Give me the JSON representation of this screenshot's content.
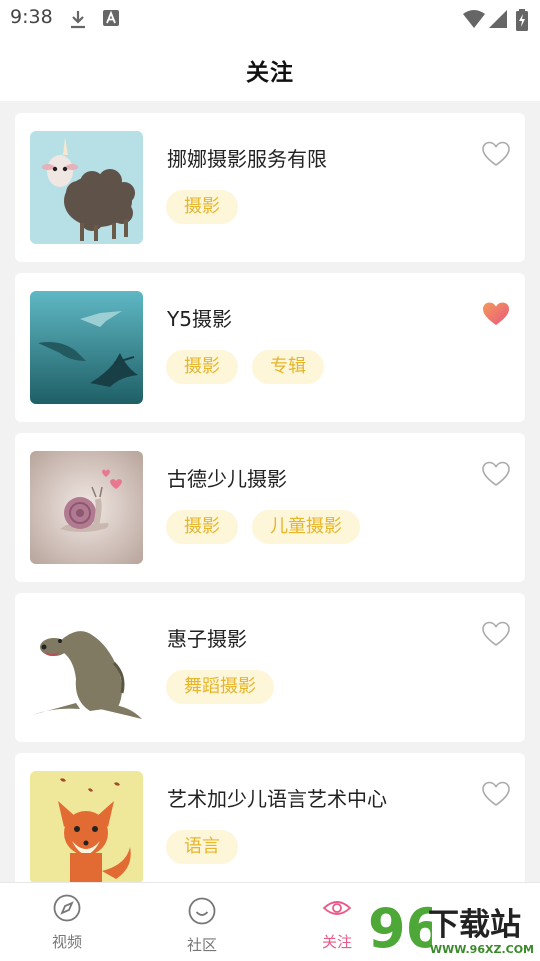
{
  "status": {
    "time": "9:38"
  },
  "header": {
    "title": "关注"
  },
  "items": [
    {
      "name": "挪娜摄影服务有限",
      "tags": [
        "摄影"
      ],
      "favorited": false
    },
    {
      "name": "Y5摄影",
      "tags": [
        "摄影",
        "专辑"
      ],
      "favorited": true
    },
    {
      "name": "古德少儿摄影",
      "tags": [
        "摄影",
        "儿童摄影"
      ],
      "favorited": false
    },
    {
      "name": "惠子摄影",
      "tags": [
        "舞蹈摄影"
      ],
      "favorited": false
    },
    {
      "name": "艺术加少儿语言艺术中心",
      "tags": [
        "语言"
      ],
      "favorited": false
    }
  ],
  "tabbar": {
    "tabs": [
      {
        "label": "视频",
        "icon": "compass-icon",
        "active": false
      },
      {
        "label": "社区",
        "icon": "smile-icon",
        "active": false
      },
      {
        "label": "关注",
        "icon": "eye-icon",
        "active": true
      }
    ]
  },
  "watermark": {
    "digits": "96",
    "text": "下载站",
    "url": "WWW.96XZ.COM"
  },
  "colors": {
    "accent": "#ea5a86",
    "tag_bg": "#fdf6d9",
    "tag_text": "#e7b52a"
  }
}
